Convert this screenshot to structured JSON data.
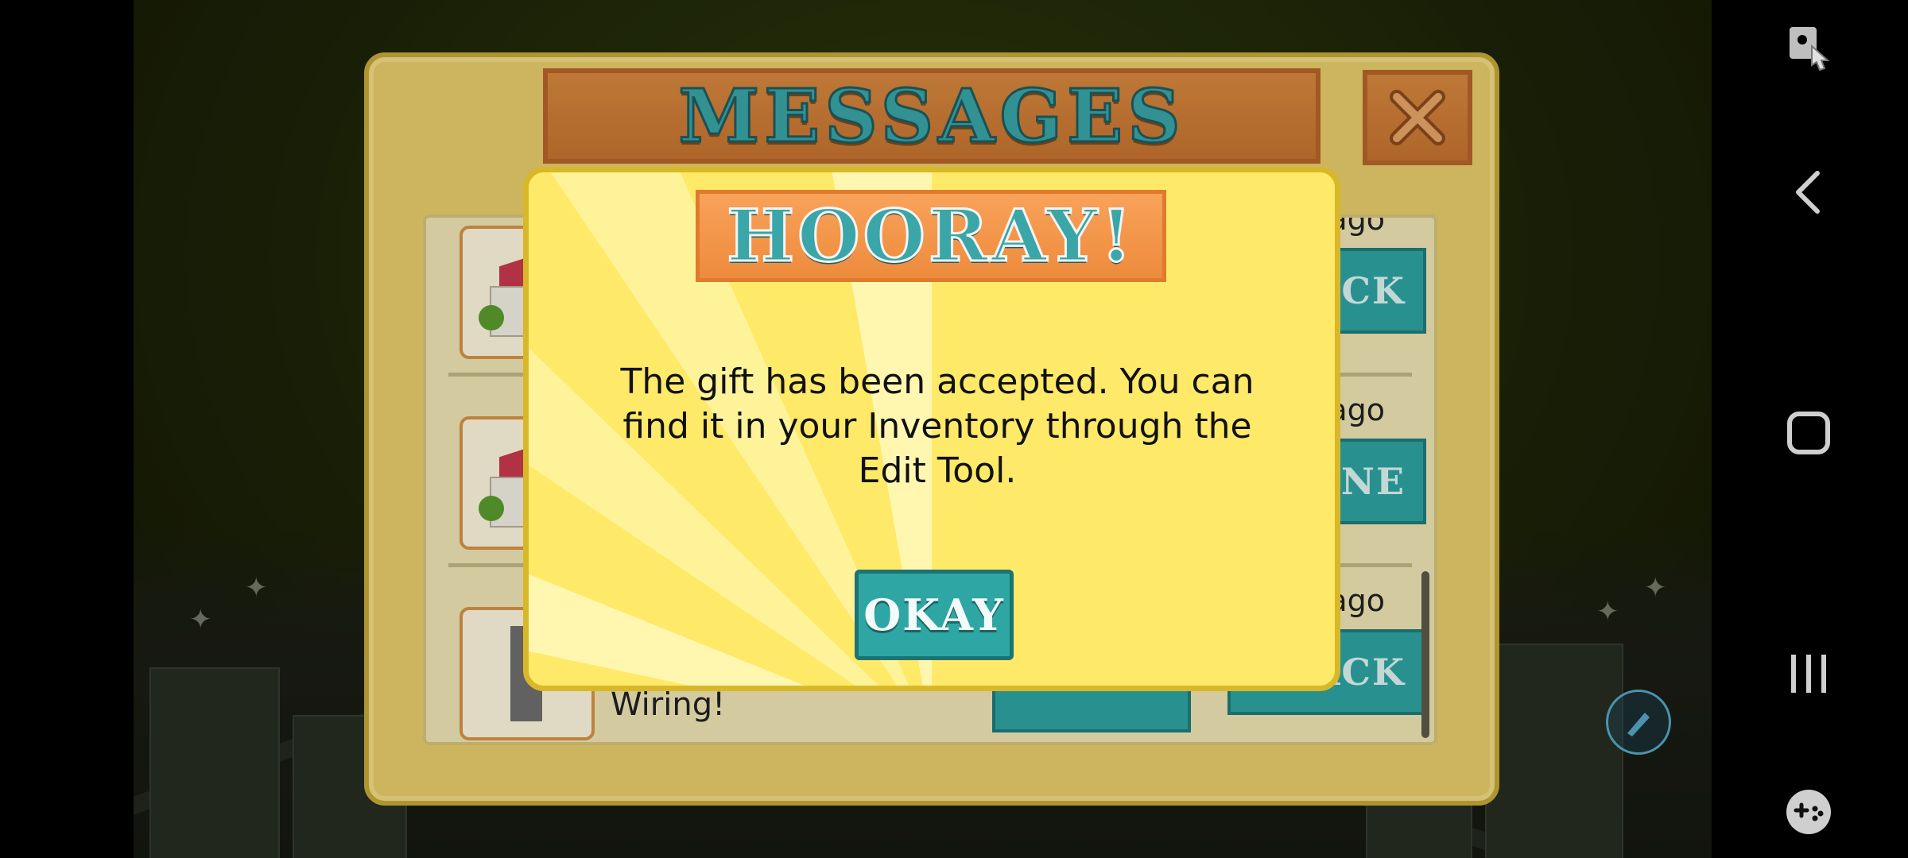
{
  "messages_panel": {
    "title": "MESSAGES",
    "close_label": "X",
    "rows": [
      {
        "time": "s ago",
        "button": "ACK"
      },
      {
        "time": "s ago",
        "button": "NE"
      },
      {
        "time": "s ago",
        "button": "ACK",
        "title": "Wiring!"
      }
    ]
  },
  "dialog": {
    "title": "HOORAY!",
    "message": "The gift has been accepted. You can find it in your Inventory through the Edit Tool.",
    "okay_label": "OKAY"
  },
  "nav": {
    "icons": [
      "screen-tap-icon",
      "back-icon",
      "home-icon",
      "recents-icon",
      "game-controller-icon"
    ]
  },
  "colors": {
    "dialog_bg": "#fff18a",
    "button_teal": "#2ea6a4",
    "plate_orange": "#ee8b3c",
    "panel_bg": "#e9cf6b"
  }
}
